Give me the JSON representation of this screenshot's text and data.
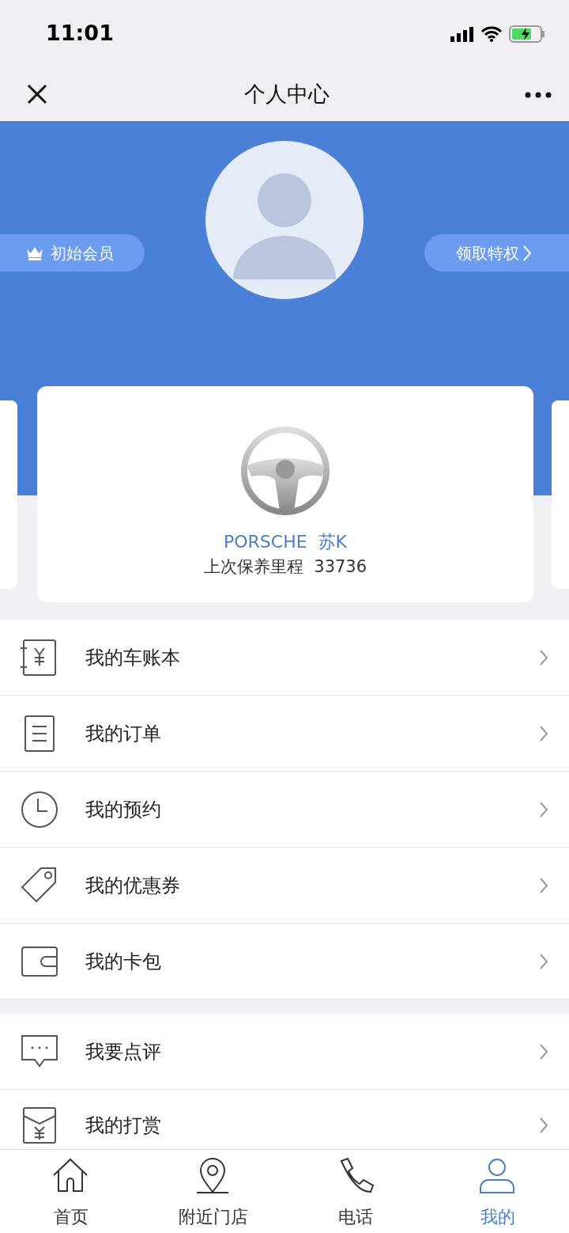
{
  "status_bar": {
    "time": "11:01"
  },
  "header": {
    "title": "个人中心"
  },
  "profile": {
    "member_level": "初始会员",
    "privilege_link": "领取特权"
  },
  "car_card": {
    "plate": "PORSCHE  苏K",
    "mileage": "上次保养里程  33736"
  },
  "menu_groups": [
    [
      {
        "kind": "ledger",
        "label": "我的车账本"
      },
      {
        "kind": "order",
        "label": "我的订单"
      },
      {
        "kind": "clock",
        "label": "我的预约"
      },
      {
        "kind": "tag",
        "label": "我的优惠券"
      },
      {
        "kind": "wallet",
        "label": "我的卡包"
      }
    ],
    [
      {
        "kind": "comment",
        "label": "我要点评"
      },
      {
        "kind": "envelope",
        "label": "我的打赏"
      }
    ]
  ],
  "tabs": [
    {
      "kind": "home",
      "label": "首页",
      "selected": false
    },
    {
      "kind": "pin",
      "label": "附近门店",
      "selected": false
    },
    {
      "kind": "phone",
      "label": "电话",
      "selected": false
    },
    {
      "kind": "person",
      "label": "我的",
      "selected": true
    }
  ]
}
